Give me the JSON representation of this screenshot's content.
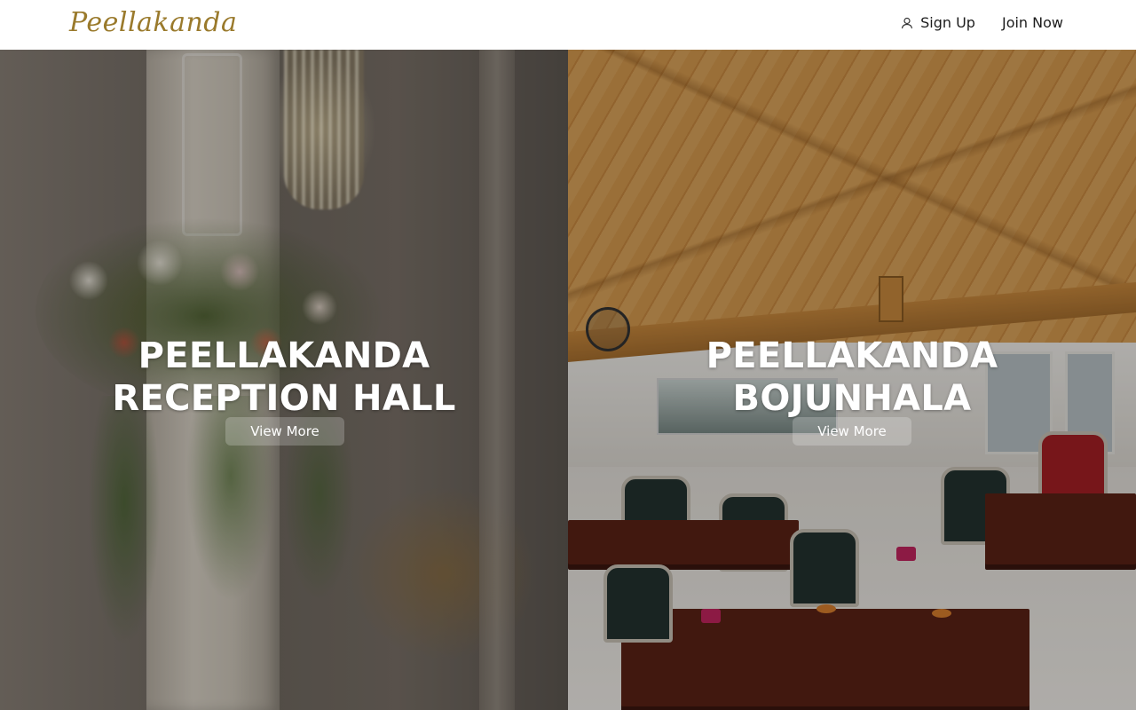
{
  "header": {
    "logo_text": "Peellakanda",
    "sign_up_label": "Sign Up",
    "join_now_label": "Join Now",
    "sign_up_icon": "user-icon"
  },
  "panels": [
    {
      "title_line1": "PEELLAKANDA",
      "title_line2": "RECEPTION HALL",
      "button_label": "View More"
    },
    {
      "title_line1": "PEELLAKANDA",
      "title_line2": "BOJUNHALA",
      "button_label": "View More"
    }
  ],
  "colors": {
    "logo": "#9a7a2c",
    "button_bg": "rgba(255,255,255,0.22)",
    "hero_text": "#ffffff"
  }
}
